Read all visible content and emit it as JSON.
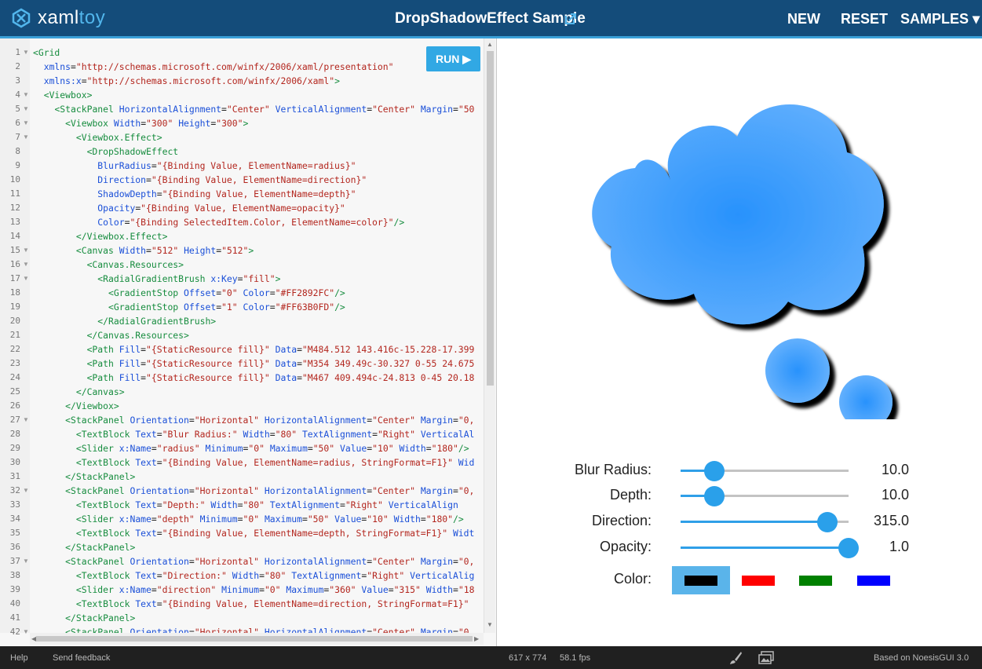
{
  "header": {
    "logo_a": "xaml",
    "logo_b": "toy",
    "title": "DropShadowEffect Sample",
    "nav": [
      "NEW",
      "RESET",
      "SAMPLES ▾"
    ]
  },
  "editor": {
    "run_label": "RUN ▶",
    "fold_lines": [
      1,
      4,
      5,
      6,
      7,
      15,
      16,
      17,
      27,
      32,
      37,
      42
    ],
    "lines": [
      [
        [
          "t",
          "<Grid"
        ]
      ],
      [
        [
          "p",
          "  "
        ],
        [
          "a",
          "xmlns"
        ],
        [
          "p",
          "="
        ],
        [
          "v",
          "\"http://schemas.microsoft.com/winfx/2006/xaml/presentation\""
        ]
      ],
      [
        [
          "p",
          "  "
        ],
        [
          "a",
          "xmlns:x"
        ],
        [
          "p",
          "="
        ],
        [
          "v",
          "\"http://schemas.microsoft.com/winfx/2006/xaml\""
        ],
        [
          "t",
          ">"
        ]
      ],
      [
        [
          "p",
          "  "
        ],
        [
          "t",
          "<Viewbox>"
        ]
      ],
      [
        [
          "p",
          "    "
        ],
        [
          "t",
          "<StackPanel "
        ],
        [
          "a",
          "HorizontalAlignment"
        ],
        [
          "p",
          "="
        ],
        [
          "v",
          "\"Center\" "
        ],
        [
          "a",
          "VerticalAlignment"
        ],
        [
          "p",
          "="
        ],
        [
          "v",
          "\"Center\" "
        ],
        [
          "a",
          "Margin"
        ],
        [
          "p",
          "="
        ],
        [
          "v",
          "\"50"
        ]
      ],
      [
        [
          "p",
          "      "
        ],
        [
          "t",
          "<Viewbox "
        ],
        [
          "a",
          "Width"
        ],
        [
          "p",
          "="
        ],
        [
          "v",
          "\"300\" "
        ],
        [
          "a",
          "Height"
        ],
        [
          "p",
          "="
        ],
        [
          "v",
          "\"300\""
        ],
        [
          "t",
          ">"
        ]
      ],
      [
        [
          "p",
          "        "
        ],
        [
          "t",
          "<Viewbox.Effect>"
        ]
      ],
      [
        [
          "p",
          "          "
        ],
        [
          "t",
          "<DropShadowEffect"
        ]
      ],
      [
        [
          "p",
          "            "
        ],
        [
          "a",
          "BlurRadius"
        ],
        [
          "p",
          "="
        ],
        [
          "v",
          "\"{Binding Value, ElementName=radius}\""
        ]
      ],
      [
        [
          "p",
          "            "
        ],
        [
          "a",
          "Direction"
        ],
        [
          "p",
          "="
        ],
        [
          "v",
          "\"{Binding Value, ElementName=direction}\""
        ]
      ],
      [
        [
          "p",
          "            "
        ],
        [
          "a",
          "ShadowDepth"
        ],
        [
          "p",
          "="
        ],
        [
          "v",
          "\"{Binding Value, ElementName=depth}\""
        ]
      ],
      [
        [
          "p",
          "            "
        ],
        [
          "a",
          "Opacity"
        ],
        [
          "p",
          "="
        ],
        [
          "v",
          "\"{Binding Value, ElementName=opacity}\""
        ]
      ],
      [
        [
          "p",
          "            "
        ],
        [
          "a",
          "Color"
        ],
        [
          "p",
          "="
        ],
        [
          "v",
          "\"{Binding SelectedItem.Color, ElementName=color}\""
        ],
        [
          "t",
          "/>"
        ]
      ],
      [
        [
          "p",
          "        "
        ],
        [
          "t",
          "</Viewbox.Effect>"
        ]
      ],
      [
        [
          "p",
          "        "
        ],
        [
          "t",
          "<Canvas "
        ],
        [
          "a",
          "Width"
        ],
        [
          "p",
          "="
        ],
        [
          "v",
          "\"512\" "
        ],
        [
          "a",
          "Height"
        ],
        [
          "p",
          "="
        ],
        [
          "v",
          "\"512\""
        ],
        [
          "t",
          ">"
        ]
      ],
      [
        [
          "p",
          "          "
        ],
        [
          "t",
          "<Canvas.Resources>"
        ]
      ],
      [
        [
          "p",
          "            "
        ],
        [
          "t",
          "<RadialGradientBrush "
        ],
        [
          "a",
          "x:Key"
        ],
        [
          "p",
          "="
        ],
        [
          "v",
          "\"fill\""
        ],
        [
          "t",
          ">"
        ]
      ],
      [
        [
          "p",
          "              "
        ],
        [
          "t",
          "<GradientStop "
        ],
        [
          "a",
          "Offset"
        ],
        [
          "p",
          "="
        ],
        [
          "v",
          "\"0\" "
        ],
        [
          "a",
          "Color"
        ],
        [
          "p",
          "="
        ],
        [
          "v",
          "\"#FF2892FC\""
        ],
        [
          "t",
          "/>"
        ]
      ],
      [
        [
          "p",
          "              "
        ],
        [
          "t",
          "<GradientStop "
        ],
        [
          "a",
          "Offset"
        ],
        [
          "p",
          "="
        ],
        [
          "v",
          "\"1\" "
        ],
        [
          "a",
          "Color"
        ],
        [
          "p",
          "="
        ],
        [
          "v",
          "\"#FF63B0FD\""
        ],
        [
          "t",
          "/>"
        ]
      ],
      [
        [
          "p",
          "            "
        ],
        [
          "t",
          "</RadialGradientBrush>"
        ]
      ],
      [
        [
          "p",
          "          "
        ],
        [
          "t",
          "</Canvas.Resources>"
        ]
      ],
      [
        [
          "p",
          "          "
        ],
        [
          "t",
          "<Path "
        ],
        [
          "a",
          "Fill"
        ],
        [
          "p",
          "="
        ],
        [
          "v",
          "\"{StaticResource fill}\" "
        ],
        [
          "a",
          "Data"
        ],
        [
          "p",
          "="
        ],
        [
          "v",
          "\"M484.512 143.416c-15.228-17.399"
        ]
      ],
      [
        [
          "p",
          "          "
        ],
        [
          "t",
          "<Path "
        ],
        [
          "a",
          "Fill"
        ],
        [
          "p",
          "="
        ],
        [
          "v",
          "\"{StaticResource fill}\" "
        ],
        [
          "a",
          "Data"
        ],
        [
          "p",
          "="
        ],
        [
          "v",
          "\"M354 349.49c-30.327 0-55 24.675"
        ]
      ],
      [
        [
          "p",
          "          "
        ],
        [
          "t",
          "<Path "
        ],
        [
          "a",
          "Fill"
        ],
        [
          "p",
          "="
        ],
        [
          "v",
          "\"{StaticResource fill}\" "
        ],
        [
          "a",
          "Data"
        ],
        [
          "p",
          "="
        ],
        [
          "v",
          "\"M467 409.494c-24.813 0-45 20.18"
        ]
      ],
      [
        [
          "p",
          "        "
        ],
        [
          "t",
          "</Canvas>"
        ]
      ],
      [
        [
          "p",
          "      "
        ],
        [
          "t",
          "</Viewbox>"
        ]
      ],
      [
        [
          "p",
          "      "
        ],
        [
          "t",
          "<StackPanel "
        ],
        [
          "a",
          "Orientation"
        ],
        [
          "p",
          "="
        ],
        [
          "v",
          "\"Horizontal\" "
        ],
        [
          "a",
          "HorizontalAlignment"
        ],
        [
          "p",
          "="
        ],
        [
          "v",
          "\"Center\" "
        ],
        [
          "a",
          "Margin"
        ],
        [
          "p",
          "="
        ],
        [
          "v",
          "\"0,"
        ]
      ],
      [
        [
          "p",
          "        "
        ],
        [
          "t",
          "<TextBlock "
        ],
        [
          "a",
          "Text"
        ],
        [
          "p",
          "="
        ],
        [
          "v",
          "\"Blur Radius:\" "
        ],
        [
          "a",
          "Width"
        ],
        [
          "p",
          "="
        ],
        [
          "v",
          "\"80\" "
        ],
        [
          "a",
          "TextAlignment"
        ],
        [
          "p",
          "="
        ],
        [
          "v",
          "\"Right\" "
        ],
        [
          "a",
          "VerticalAl"
        ]
      ],
      [
        [
          "p",
          "        "
        ],
        [
          "t",
          "<Slider "
        ],
        [
          "a",
          "x:Name"
        ],
        [
          "p",
          "="
        ],
        [
          "v",
          "\"radius\" "
        ],
        [
          "a",
          "Minimum"
        ],
        [
          "p",
          "="
        ],
        [
          "v",
          "\"0\" "
        ],
        [
          "a",
          "Maximum"
        ],
        [
          "p",
          "="
        ],
        [
          "v",
          "\"50\" "
        ],
        [
          "a",
          "Value"
        ],
        [
          "p",
          "="
        ],
        [
          "v",
          "\"10\" "
        ],
        [
          "a",
          "Width"
        ],
        [
          "p",
          "="
        ],
        [
          "v",
          "\"180\""
        ],
        [
          "t",
          "/>"
        ]
      ],
      [
        [
          "p",
          "        "
        ],
        [
          "t",
          "<TextBlock "
        ],
        [
          "a",
          "Text"
        ],
        [
          "p",
          "="
        ],
        [
          "v",
          "\"{Binding Value, ElementName=radius, StringFormat=F1}\" "
        ],
        [
          "a",
          "Wid"
        ]
      ],
      [
        [
          "p",
          "      "
        ],
        [
          "t",
          "</StackPanel>"
        ]
      ],
      [
        [
          "p",
          "      "
        ],
        [
          "t",
          "<StackPanel "
        ],
        [
          "a",
          "Orientation"
        ],
        [
          "p",
          "="
        ],
        [
          "v",
          "\"Horizontal\" "
        ],
        [
          "a",
          "HorizontalAlignment"
        ],
        [
          "p",
          "="
        ],
        [
          "v",
          "\"Center\" "
        ],
        [
          "a",
          "Margin"
        ],
        [
          "p",
          "="
        ],
        [
          "v",
          "\"0,"
        ]
      ],
      [
        [
          "p",
          "        "
        ],
        [
          "t",
          "<TextBlock "
        ],
        [
          "a",
          "Text"
        ],
        [
          "p",
          "="
        ],
        [
          "v",
          "\"Depth:\" "
        ],
        [
          "a",
          "Width"
        ],
        [
          "p",
          "="
        ],
        [
          "v",
          "\"80\" "
        ],
        [
          "a",
          "TextAlignment"
        ],
        [
          "p",
          "="
        ],
        [
          "v",
          "\"Right\" "
        ],
        [
          "a",
          "VerticalAlign"
        ]
      ],
      [
        [
          "p",
          "        "
        ],
        [
          "t",
          "<Slider "
        ],
        [
          "a",
          "x:Name"
        ],
        [
          "p",
          "="
        ],
        [
          "v",
          "\"depth\" "
        ],
        [
          "a",
          "Minimum"
        ],
        [
          "p",
          "="
        ],
        [
          "v",
          "\"0\" "
        ],
        [
          "a",
          "Maximum"
        ],
        [
          "p",
          "="
        ],
        [
          "v",
          "\"50\" "
        ],
        [
          "a",
          "Value"
        ],
        [
          "p",
          "="
        ],
        [
          "v",
          "\"10\" "
        ],
        [
          "a",
          "Width"
        ],
        [
          "p",
          "="
        ],
        [
          "v",
          "\"180\""
        ],
        [
          "t",
          "/>"
        ]
      ],
      [
        [
          "p",
          "        "
        ],
        [
          "t",
          "<TextBlock "
        ],
        [
          "a",
          "Text"
        ],
        [
          "p",
          "="
        ],
        [
          "v",
          "\"{Binding Value, ElementName=depth, StringFormat=F1}\" "
        ],
        [
          "a",
          "Widt"
        ]
      ],
      [
        [
          "p",
          "      "
        ],
        [
          "t",
          "</StackPanel>"
        ]
      ],
      [
        [
          "p",
          "      "
        ],
        [
          "t",
          "<StackPanel "
        ],
        [
          "a",
          "Orientation"
        ],
        [
          "p",
          "="
        ],
        [
          "v",
          "\"Horizontal\" "
        ],
        [
          "a",
          "HorizontalAlignment"
        ],
        [
          "p",
          "="
        ],
        [
          "v",
          "\"Center\" "
        ],
        [
          "a",
          "Margin"
        ],
        [
          "p",
          "="
        ],
        [
          "v",
          "\"0,"
        ]
      ],
      [
        [
          "p",
          "        "
        ],
        [
          "t",
          "<TextBlock "
        ],
        [
          "a",
          "Text"
        ],
        [
          "p",
          "="
        ],
        [
          "v",
          "\"Direction:\" "
        ],
        [
          "a",
          "Width"
        ],
        [
          "p",
          "="
        ],
        [
          "v",
          "\"80\" "
        ],
        [
          "a",
          "TextAlignment"
        ],
        [
          "p",
          "="
        ],
        [
          "v",
          "\"Right\" "
        ],
        [
          "a",
          "VerticalAlig"
        ]
      ],
      [
        [
          "p",
          "        "
        ],
        [
          "t",
          "<Slider "
        ],
        [
          "a",
          "x:Name"
        ],
        [
          "p",
          "="
        ],
        [
          "v",
          "\"direction\" "
        ],
        [
          "a",
          "Minimum"
        ],
        [
          "p",
          "="
        ],
        [
          "v",
          "\"0\" "
        ],
        [
          "a",
          "Maximum"
        ],
        [
          "p",
          "="
        ],
        [
          "v",
          "\"360\" "
        ],
        [
          "a",
          "Value"
        ],
        [
          "p",
          "="
        ],
        [
          "v",
          "\"315\" "
        ],
        [
          "a",
          "Width"
        ],
        [
          "p",
          "="
        ],
        [
          "v",
          "\"18"
        ]
      ],
      [
        [
          "p",
          "        "
        ],
        [
          "t",
          "<TextBlock "
        ],
        [
          "a",
          "Text"
        ],
        [
          "p",
          "="
        ],
        [
          "v",
          "\"{Binding Value, ElementName=direction, StringFormat=F1}\""
        ]
      ],
      [
        [
          "p",
          "      "
        ],
        [
          "t",
          "</StackPanel>"
        ]
      ],
      [
        [
          "p",
          "      "
        ],
        [
          "t",
          "<StackPanel "
        ],
        [
          "a",
          "Orientation"
        ],
        [
          "p",
          "="
        ],
        [
          "v",
          "\"Horizontal\" "
        ],
        [
          "a",
          "HorizontalAlignment"
        ],
        [
          "p",
          "="
        ],
        [
          "v",
          "\"Center\" "
        ],
        [
          "a",
          "Margin"
        ],
        [
          "p",
          "="
        ],
        [
          "v",
          "\"0,"
        ]
      ]
    ]
  },
  "preview": {
    "sliders": [
      {
        "label": "Blur Radius:",
        "value_text": "10.0",
        "fraction": 0.2
      },
      {
        "label": "Depth:",
        "value_text": "10.0",
        "fraction": 0.2
      },
      {
        "label": "Direction:",
        "value_text": "315.0",
        "fraction": 0.875
      },
      {
        "label": "Opacity:",
        "value_text": "1.0",
        "fraction": 1.0
      }
    ],
    "color_label": "Color:",
    "colors": [
      {
        "name": "black",
        "hex": "#000000",
        "selected": true
      },
      {
        "name": "red",
        "hex": "#ff0000",
        "selected": false
      },
      {
        "name": "green",
        "hex": "#008000",
        "selected": false
      },
      {
        "name": "blue",
        "hex": "#0000ff",
        "selected": false
      }
    ],
    "accent": "#2aa0ea"
  },
  "footer": {
    "help": "Help",
    "feedback": "Send feedback",
    "resolution": "617 x 774",
    "fps": "58.1 fps",
    "brand": "Based on NoesisGUI 3.0"
  }
}
